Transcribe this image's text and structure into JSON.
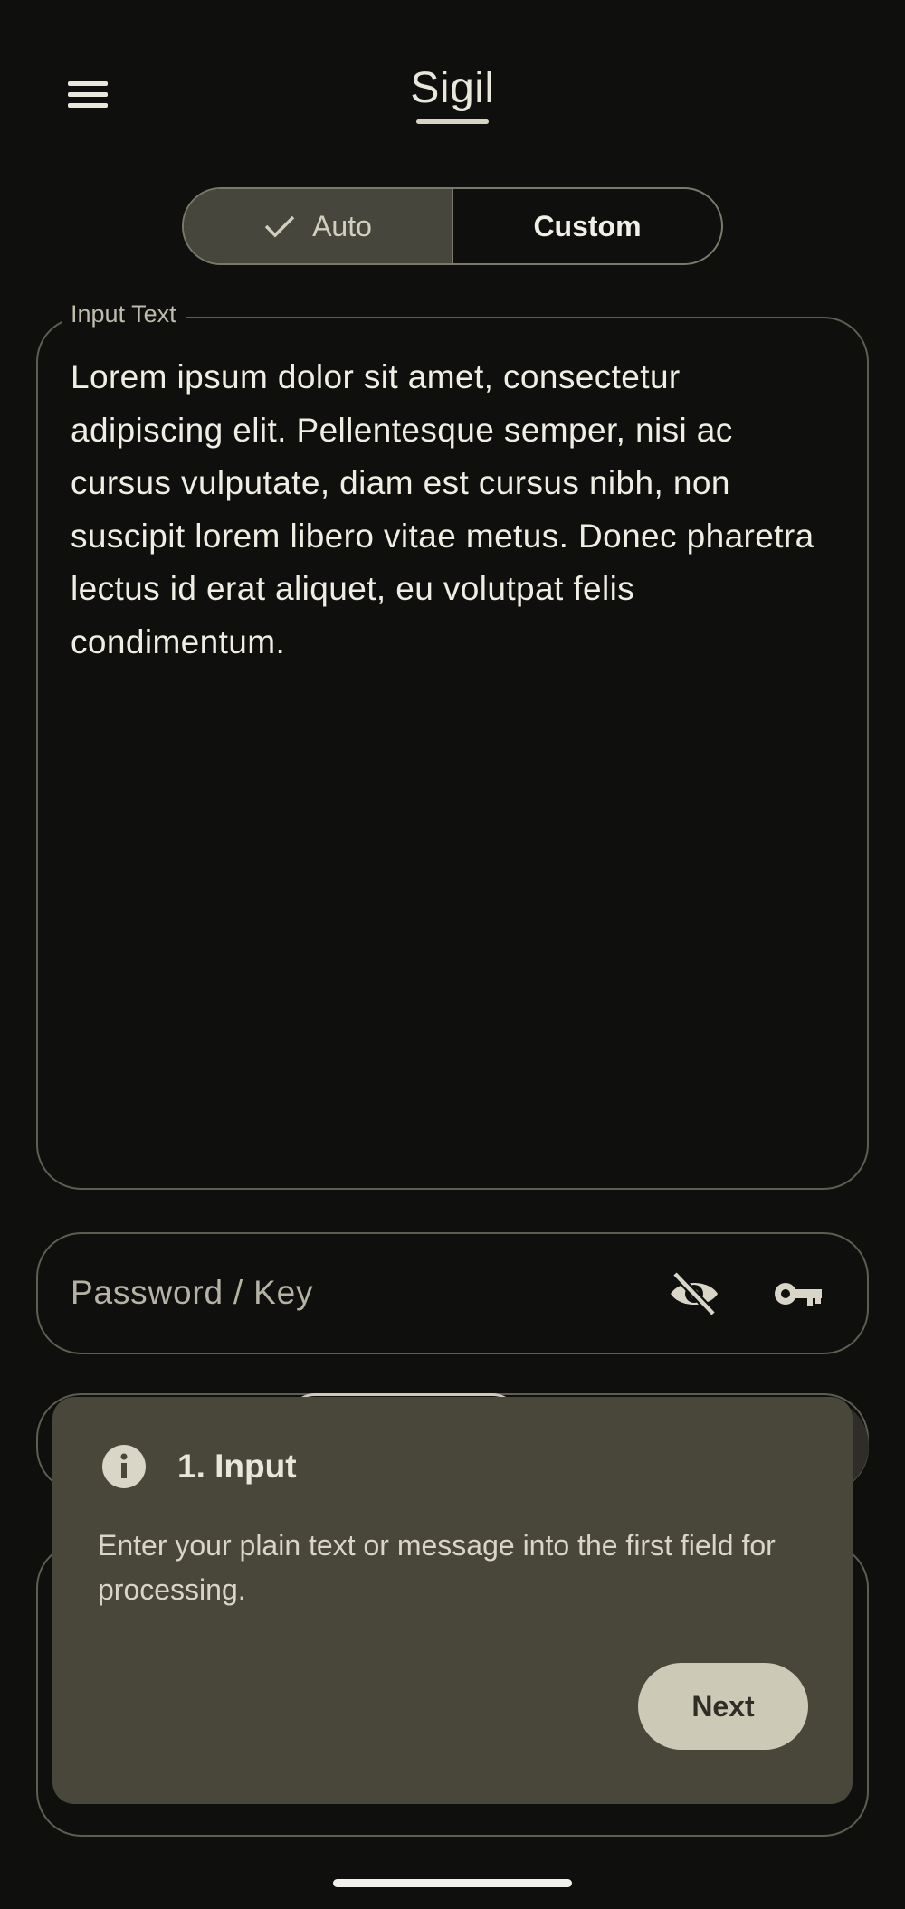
{
  "app": {
    "title": "Sigil"
  },
  "mode_toggle": {
    "options": [
      {
        "label": "Auto",
        "selected": true
      },
      {
        "label": "Custom",
        "selected": false
      }
    ]
  },
  "input": {
    "label": "Input Text",
    "value": "Lorem ipsum dolor sit amet, consectetur adipiscing elit. Pellentesque semper, nisi ac cursus vulputate, diam est cursus nibh, non suscipit lorem libero vitae metus. Donec pharetra lectus id erat aliquet, eu volutpat felis condimentum."
  },
  "password": {
    "placeholder": "Password / Key",
    "visibility_icon": "visibility-off-icon",
    "key_icon": "key-icon"
  },
  "tooltip": {
    "title": "1. Input",
    "body": "Enter your plain text or message into the first field for processing.",
    "next_label": "Next",
    "icon": "info-icon"
  },
  "colors": {
    "background": "#0f0f0e",
    "tooltip_bg": "#49473a",
    "accent": "#cdc9b7",
    "outline": "#5f5d50"
  }
}
